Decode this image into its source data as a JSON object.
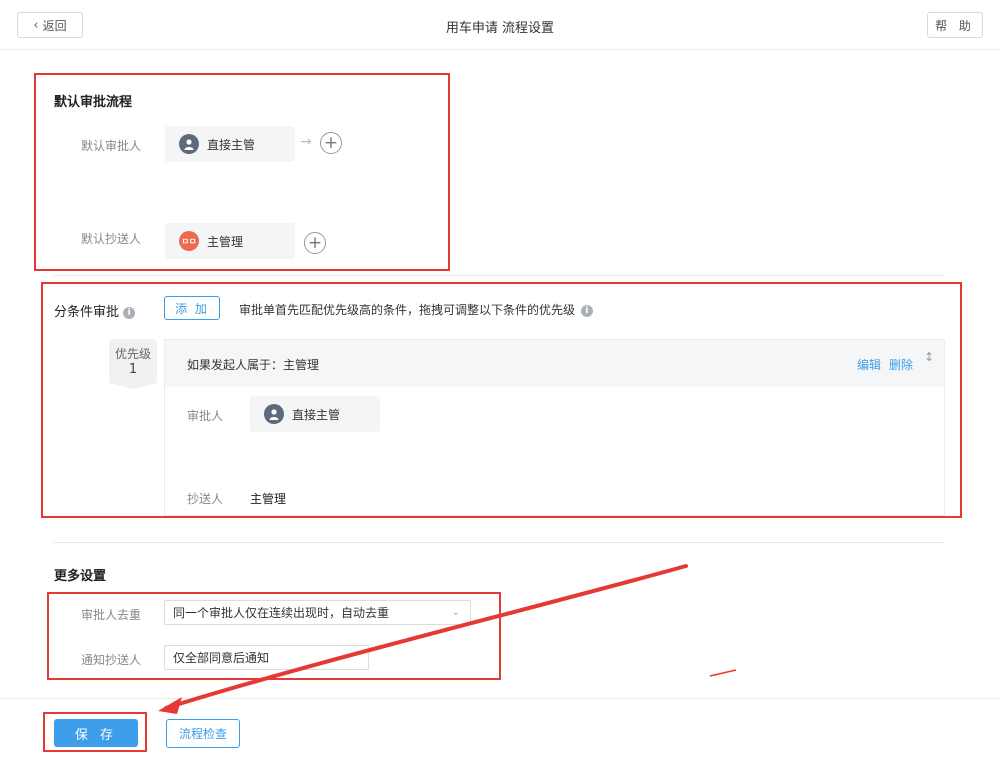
{
  "header": {
    "back_label": "返回",
    "title": "用车申请 流程设置",
    "help_label": "帮 助"
  },
  "default_flow": {
    "title": "默认审批流程",
    "approver_label": "默认审批人",
    "approver_chip": "直接主管",
    "cc_label": "默认抄送人",
    "cc_chip": "主管理",
    "cc_avatar_text": "ㅁㅁ"
  },
  "conditional": {
    "title": "分条件审批",
    "add_label": "添 加",
    "hint": "审批单首先匹配优先级高的条件，拖拽可调整以下条件的优先级",
    "priority_label": "优先级",
    "priority_value": "1",
    "condition_text": "如果发起人属于：主管理",
    "edit_label": "编辑",
    "delete_label": "删除",
    "approver_label": "审批人",
    "approver_chip": "直接主管",
    "cc_label": "抄送人",
    "cc_value": "主管理"
  },
  "more": {
    "title": "更多设置",
    "dedupe_label": "审批人去重",
    "dedupe_value": "同一个审批人仅在连续出现时，自动去重",
    "notify_label": "通知抄送人",
    "notify_value": "仅全部同意后通知"
  },
  "footer": {
    "save_label": "保 存",
    "check_label": "流程检查"
  },
  "colors": {
    "accent": "#3d9de8",
    "annotation_red": "#e53935"
  },
  "icons": [
    "chevron-left-icon",
    "user-icon",
    "arrow-right-icon",
    "plus-circle-icon",
    "info-icon",
    "drag-handle-icon",
    "chevron-down-icon"
  ]
}
